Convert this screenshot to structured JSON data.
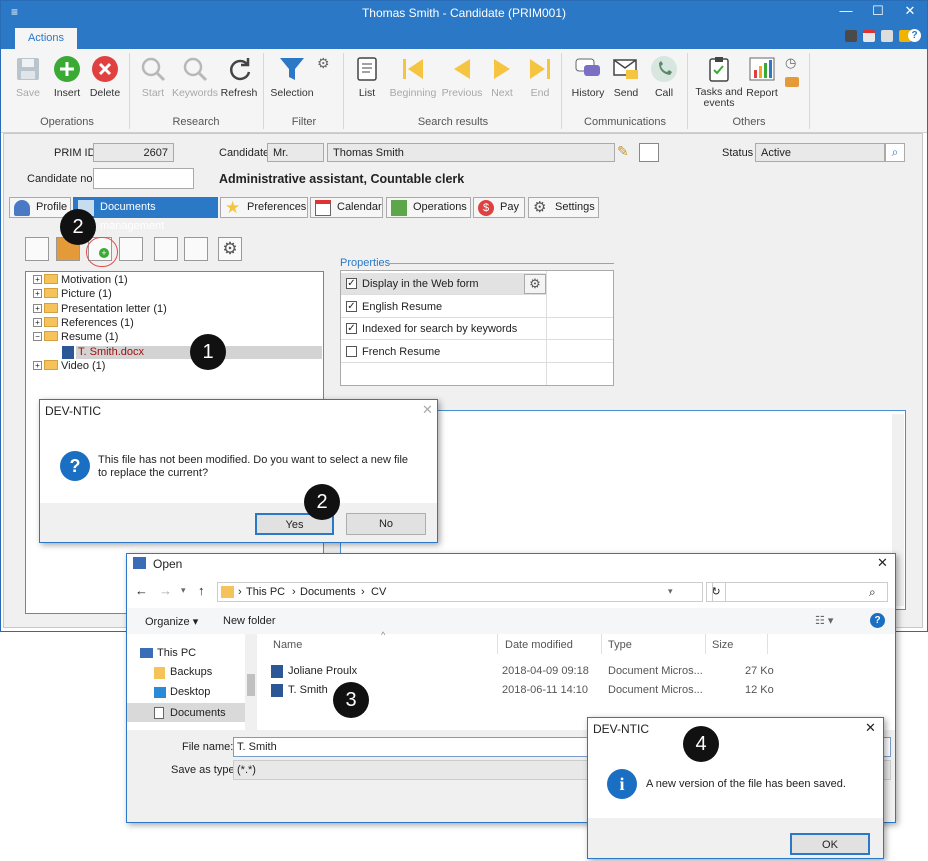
{
  "window": {
    "title": "Thomas Smith - Candidate (PRIM001)",
    "min": "—",
    "max": "☐",
    "close": "✕",
    "menu": "≡"
  },
  "ribbon": {
    "tab": "Actions",
    "buttons": {
      "save": "Save",
      "insert": "Insert",
      "delete": "Delete",
      "start": "Start",
      "keywords": "Keywords",
      "refresh": "Refresh",
      "selection": "Selection",
      "list": "List",
      "beginning": "Beginning",
      "previous": "Previous",
      "next": "Next",
      "end": "End",
      "history": "History",
      "send": "Send",
      "call": "Call",
      "tasks": "Tasks and\nevents",
      "report": "Report"
    },
    "groups": {
      "operations": "Operations",
      "research": "Research",
      "filter": "Filter",
      "search_results": "Search results",
      "communications": "Communications",
      "others": "Others"
    }
  },
  "form": {
    "prim_id_label": "PRIM ID",
    "prim_id": "2607",
    "candidate_label": "Candidate",
    "title": "Mr.",
    "name": "Thomas Smith",
    "status_label": "Status",
    "status": "Active",
    "candidate_no_label": "Candidate no.",
    "candidate_no": "",
    "headline": "Administrative assistant, Countable clerk"
  },
  "tabs": [
    "Profile",
    "Documents management",
    "Preferences",
    "Calendar",
    "Operations",
    "Pay",
    "Settings"
  ],
  "tree": {
    "items": [
      "Motivation (1)",
      "Picture (1)",
      "Presentation letter (1)",
      "References (1)",
      "Resume (1)",
      "Video (1)"
    ],
    "file": "T. Smith.docx"
  },
  "properties": {
    "title": "Properties",
    "rows": [
      {
        "label": "Display in the Web form",
        "checked": "✓"
      },
      {
        "label": "English Resume",
        "checked": "✓"
      },
      {
        "label": "Indexed for search by keywords",
        "checked": "✓"
      },
      {
        "label": "French Resume",
        "checked": ""
      }
    ]
  },
  "confirm_dialog": {
    "title": "DEV-NTIC",
    "message": "This file has not been modified. Do you want to select a new file to replace the current?",
    "yes": "Yes",
    "no": "No",
    "icon": "?"
  },
  "open_dialog": {
    "title": "Open",
    "path": [
      "This PC",
      "Documents",
      "CV"
    ],
    "organize": "Organize ▾",
    "new_folder": "New folder",
    "nav": [
      "This PC",
      "Backups",
      "Desktop",
      "Documents"
    ],
    "columns": [
      "Name",
      "Date modified",
      "Type",
      "Size"
    ],
    "files": [
      {
        "name": "Joliane Proulx",
        "date": "2018-04-09 09:18",
        "type": "Document Micros...",
        "size": "27 Ko"
      },
      {
        "name": "T. Smith",
        "date": "2018-06-11 14:10",
        "type": "Document Micros...",
        "size": "12 Ko"
      }
    ],
    "file_name_label": "File name:",
    "file_name": "T. Smith",
    "save_type_label": "Save as type:",
    "save_type": "(*.*)"
  },
  "info_dialog": {
    "title": "DEV-NTIC",
    "message": "A new version of the file has been saved.",
    "ok": "OK",
    "icon": "i"
  },
  "badges": {
    "b1": "1",
    "b2a": "2",
    "b2b": "2",
    "b3": "3",
    "b4": "4"
  },
  "colors": {
    "accent": "#2b78c6",
    "insert": "#3aaa35",
    "delete": "#e04040"
  }
}
